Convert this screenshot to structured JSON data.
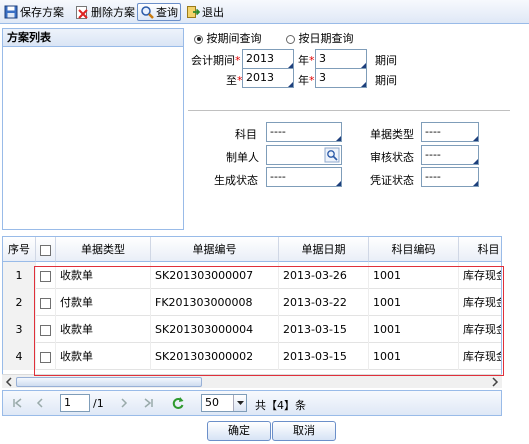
{
  "toolbar": {
    "save_label": "保存方案",
    "delete_label": "删除方案",
    "query_label": "查询",
    "exit_label": "退出"
  },
  "scheme_list": {
    "title": "方案列表"
  },
  "query": {
    "by_period_label": "按期间查询",
    "by_date_label": "按日期查询",
    "selected_mode": "by_period",
    "period_label": "会计期间",
    "to_label": "至",
    "year_label": "年",
    "period_unit": "期间",
    "from_year": "2013",
    "from_period": "3",
    "to_year": "2013",
    "to_period": "3"
  },
  "filters": {
    "subject_label": "科目",
    "subject_value": "----",
    "doc_type_label": "单据类型",
    "doc_type_value": "----",
    "creator_label": "制单人",
    "creator_value": "",
    "audit_label": "审核状态",
    "audit_value": "----",
    "gen_label": "生成状态",
    "gen_value": "----",
    "voucher_label": "凭证状态",
    "voucher_value": "----"
  },
  "grid": {
    "columns": [
      "序号",
      "",
      "单据类型",
      "单据编号",
      "单据日期",
      "科目编码",
      "科目"
    ],
    "rows": [
      {
        "no": "1",
        "type": "收款单",
        "code": "SK201303000007",
        "date": "2013-03-26",
        "subject_code": "1001",
        "subject": "库存现金"
      },
      {
        "no": "2",
        "type": "付款单",
        "code": "FK201303000008",
        "date": "2013-03-22",
        "subject_code": "1001",
        "subject": "库存现金"
      },
      {
        "no": "3",
        "type": "收款单",
        "code": "SK201303000004",
        "date": "2013-03-15",
        "subject_code": "1001",
        "subject": "库存现金"
      },
      {
        "no": "4",
        "type": "收款单",
        "code": "SK201303000002",
        "date": "2013-03-15",
        "subject_code": "1001",
        "subject": "库存现金"
      }
    ]
  },
  "pager": {
    "page": "1",
    "total_pages": "/1",
    "page_size": "50",
    "total_text": "共【4】条"
  },
  "buttons": {
    "ok_label": "确定",
    "cancel_label": "取消"
  },
  "colors": {
    "accent": "#99bbe8",
    "highlight": "#e0303a"
  }
}
